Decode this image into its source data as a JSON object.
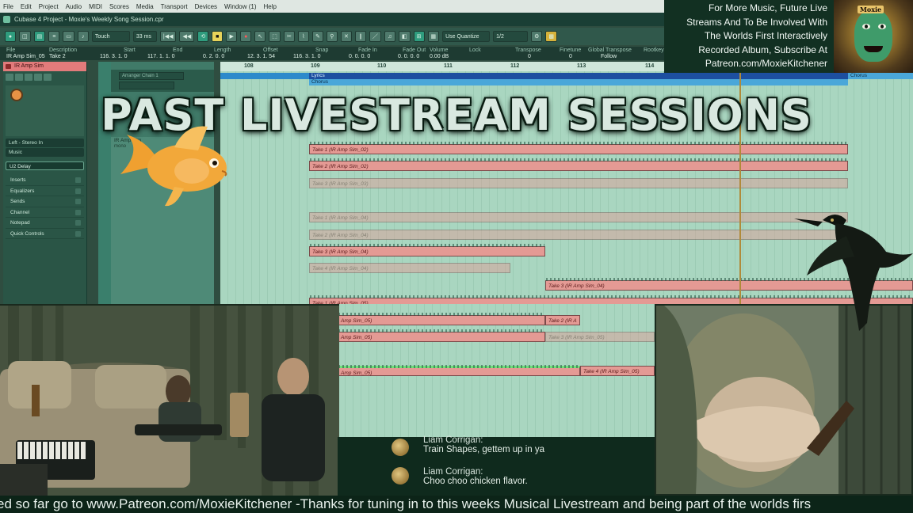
{
  "menu": [
    "File",
    "Edit",
    "Project",
    "Audio",
    "MIDI",
    "Scores",
    "Media",
    "Transport",
    "Devices",
    "Window (1)",
    "Help"
  ],
  "window_title": "Cubase 4 Project - Moxie's Weekly Song Session.cpr",
  "toolbar": {
    "automation_mode": "Touch",
    "latency": "33 ms",
    "quantize_mode": "Use Quantize",
    "quantize_value": "1/2"
  },
  "info_line": {
    "headers": [
      "File",
      "Description",
      "Start",
      "End",
      "Length",
      "Offset",
      "Snap",
      "Fade In",
      "Fade Out",
      "Volume",
      "Lock",
      "Transpose",
      "Finetune",
      "Global Transpose",
      "Rootkey"
    ],
    "values": [
      "IR Amp Sim_05",
      "Take 2",
      "116. 3. 1. 0",
      "117. 1. 1. 0",
      "0. 2. 0. 0",
      "12. 3. 1. 54",
      "116. 3. 1. 0",
      "0. 0. 0. 0",
      "0. 0. 0. 0",
      "0.00 dB",
      "",
      "0",
      "0",
      "Follow",
      ""
    ]
  },
  "inspector": {
    "track_name": "IR Amp Sim",
    "input_output": "Left - Stereo In",
    "output": "Music",
    "insert": "U2 Delay",
    "sections": [
      "Inserts",
      "Equalizers",
      "Sends",
      "Channel",
      "Notepad",
      "Quick Controls"
    ]
  },
  "tracklist": {
    "arranger": "Arranger Chain 1",
    "track_label": "IR Amp Sim",
    "track_sub": "mono"
  },
  "ruler": {
    "bars": [
      "108",
      "109",
      "110",
      "111",
      "112",
      "113",
      "114"
    ]
  },
  "arranger_track": {
    "lyrics": "Lyrics",
    "chorus_a": "Chorus",
    "chorus_b": "Chorus"
  },
  "clips": [
    "Take 1 (IR Amp Sim_02)",
    "Take 2 (IR Amp Sim_02)",
    "Take 3 (IR Amp Sim_03)",
    "Take 1 (IR Amp Sim_04)",
    "Take 2 (IR Amp Sim_04)",
    "Take 3 (IR Amp Sim_04)",
    "Take 4 (IR Amp Sim_04)",
    "Take 3 (IR Amp Sim_04)",
    "Take 1 (IR Amp Sim_05)",
    "Amp Sim_05)",
    "Take 2 (IR A",
    "Amp Sim_05)",
    "Take 3 (IR Amp Sim_05)",
    "Amp Sim_05)",
    "Take 4 (IR Amp Sim_05)"
  ],
  "promo": {
    "lines": [
      "For More Music, Future Live",
      "Streams And To Be Involved With",
      "The Worlds First Interactively",
      "Recorded Album, Subscribe At",
      "Patreon.com/MoxieKitchener"
    ],
    "avatar_tag": "Moxie"
  },
  "headline": "PAST LIVESTREAM SESSIONS",
  "chat": [
    {
      "user": "Liam Corrigan:",
      "text": "Train Shapes, gettem up in ya"
    },
    {
      "user": "Liam Corrigan:",
      "text": "Choo choo chicken flavor."
    }
  ],
  "ticker": "ed so far go to www.Patreon.com/MoxieKitchener -Thanks for tuning in to this weeks Musical Livestream and being part of the worlds firs"
}
